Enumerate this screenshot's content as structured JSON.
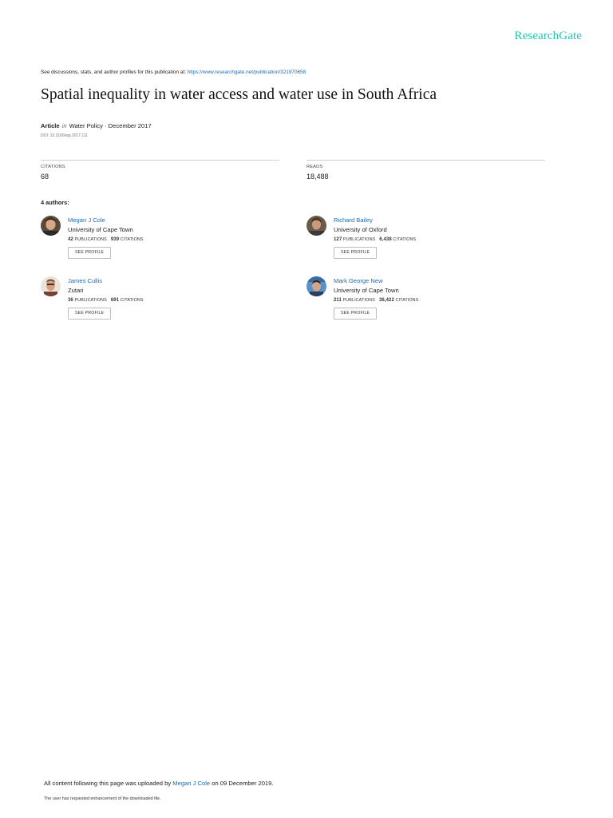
{
  "brand": {
    "logo_text": "ResearchGate",
    "accent": "#1ec8b4",
    "link_color": "#1f6bb0"
  },
  "notice": {
    "text": "See discussions, stats, and author profiles for this publication at: ",
    "link": "https://www.researchgate.net/publication/321970658"
  },
  "publication": {
    "title": "Spatial inequality in water access and water use in South Africa",
    "type": "Article",
    "in_label": "in",
    "venue_date": "Water Policy · December 2017",
    "doi": "DOI: 10.2166/wp.2017.111"
  },
  "stats": {
    "citations_label": "CITATIONS",
    "citations_value": "68",
    "reads_label": "READS",
    "reads_value": "18,488"
  },
  "authors_heading": "4 authors:",
  "authors": [
    {
      "name": "Megan J Cole",
      "institution": "University of Cape Town",
      "publications": "42",
      "publications_label": "PUBLICATIONS",
      "citations": "939",
      "citations_label": "CITATIONS",
      "button": "SEE PROFILE"
    },
    {
      "name": "Richard Bailey",
      "institution": "University of Oxford",
      "publications": "127",
      "publications_label": "PUBLICATIONS",
      "citations": "6,438",
      "citations_label": "CITATIONS",
      "button": "SEE PROFILE"
    },
    {
      "name": "James Cullis",
      "institution": "Zutari",
      "publications": "36",
      "publications_label": "PUBLICATIONS",
      "citations": "691",
      "citations_label": "CITATIONS",
      "button": "SEE PROFILE"
    },
    {
      "name": "Mark George New",
      "institution": "University of Cape Town",
      "publications": "211",
      "publications_label": "PUBLICATIONS",
      "citations": "36,422",
      "citations_label": "CITATIONS",
      "button": "SEE PROFILE"
    }
  ],
  "footer": {
    "prefix": "All content following this page was uploaded by ",
    "uploader": "Megan J Cole",
    "suffix": " on 09 December 2019.",
    "note": "The user has requested enhancement of the downloaded file."
  }
}
